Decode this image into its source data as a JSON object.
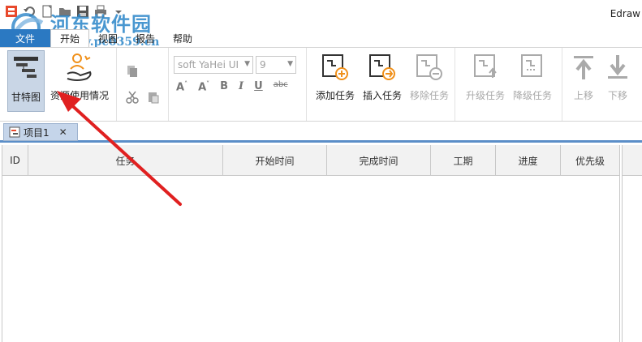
{
  "app": {
    "title": "Edraw"
  },
  "watermark": {
    "site_name": "河东软件园",
    "url": "www.pc0359.cn"
  },
  "menu": {
    "file": "文件",
    "tabs": [
      {
        "label": "开始",
        "active": true
      },
      {
        "label": "视图",
        "active": false
      },
      {
        "label": "报告",
        "active": false
      },
      {
        "label": "帮助",
        "active": false
      }
    ]
  },
  "ribbon": {
    "gantt": "甘特图",
    "resource_usage": "资源使用情况",
    "font_family": "soft YaHei UI",
    "font_size": "9",
    "add_task": "添加任务",
    "insert_task": "插入任务",
    "remove_task": "移除任务",
    "promote_task": "升级任务",
    "demote_task": "降级任务",
    "move_up": "上移",
    "move_down": "下移",
    "format_buttons": {
      "grow_font": "A",
      "shrink_font": "A",
      "bold": "B",
      "italic": "I",
      "underline": "U",
      "strikethrough": "abc"
    }
  },
  "document": {
    "tab_label": "项目1",
    "close_glyph": "✕"
  },
  "grid": {
    "columns": [
      "ID",
      "任务",
      "开始时间",
      "完成时间",
      "工期",
      "进度",
      "优先级"
    ]
  },
  "colors": {
    "file_tab": "#2b79c2",
    "annotation_arrow": "#e02020",
    "active_doc_tab": "#c5d5ea",
    "accent_orange": "#f0901a"
  }
}
